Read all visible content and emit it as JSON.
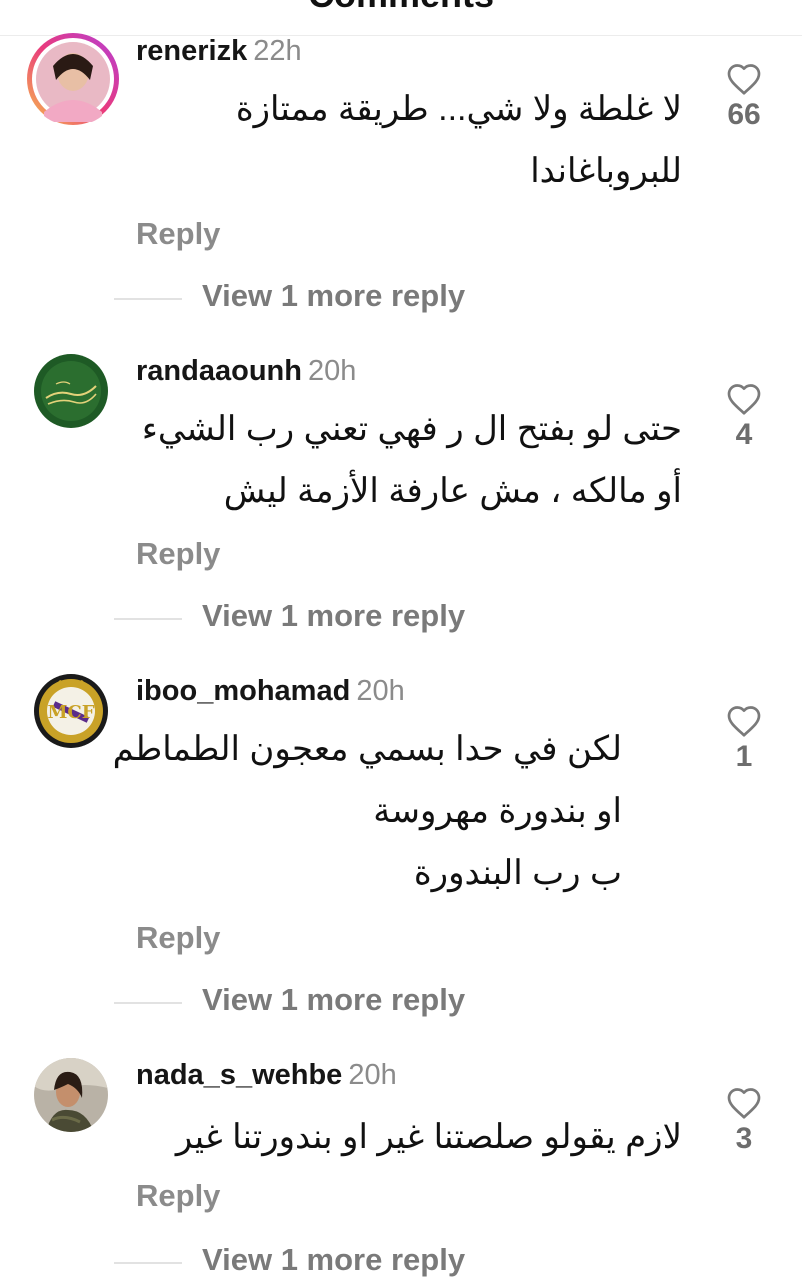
{
  "header": {
    "title": "Comments"
  },
  "comments": [
    {
      "username": "renerizk",
      "time": "22h",
      "lines": [
        "لا غلطة ولا شي... طريقة ممتازة",
        "للبروباغاندا"
      ],
      "likes": "66",
      "reply_label": "Reply",
      "view_more": "View 1 more reply"
    },
    {
      "username": "randaaounh",
      "time": "20h",
      "lines": [
        "حتى لو بفتح ال ر فهي تعني رب الشيء",
        "أو مالكه ، مش عارفة الأزمة ليش"
      ],
      "likes": "4",
      "reply_label": "Reply",
      "view_more": "View 1 more reply"
    },
    {
      "username": "iboo_mohamad",
      "time": "20h",
      "lines": [
        "لكن في حدا بسمي معجون الطماطم",
        "او بندورة مهروسة",
        "ب رب البندورة"
      ],
      "likes": "1",
      "reply_label": "Reply",
      "view_more": "View 1 more reply"
    },
    {
      "username": "nada_s_wehbe",
      "time": "20h",
      "lines": [
        "لازم يقولو صلصتنا غير او بندورتنا غير"
      ],
      "likes": "3",
      "reply_label": "Reply",
      "view_more": "View 1 more reply"
    }
  ],
  "colors": {
    "time": "#8b8b8b",
    "reply": "#8b8b8b",
    "view_more": "#7a7a7a",
    "divider": "#e2e2e2"
  },
  "icons": {
    "like": "heart-outline-icon"
  }
}
